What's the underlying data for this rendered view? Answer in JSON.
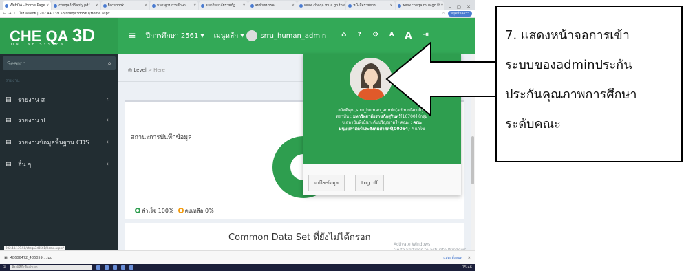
{
  "browser": {
    "tabs": [
      {
        "label": "WebQA - Home Page",
        "active": true
      },
      {
        "label": "cheqa3d3apty.pdf",
        "active": false
      },
      {
        "label": "Facebook",
        "active": false
      },
      {
        "label": "มาตรฐานการศึกษา",
        "active": false
      },
      {
        "label": "มหาวิทยาลัยราชภัฏ",
        "active": false
      },
      {
        "label": "สหพันธมรรค",
        "active": false
      },
      {
        "label": "www.cheqa.mua.go.th",
        "active": false
      },
      {
        "label": "หนังสือราชการ",
        "active": false
      },
      {
        "label": "www.cheqa.mua.go.th",
        "active": false
      }
    ],
    "window_controls": [
      "–",
      "▢",
      "✕"
    ],
    "url": "ไม่ปลอดภัย | 202.44.139.58/cheqa3d3561/Home.aspx",
    "profile_badge": "หยุดชั่วคราว"
  },
  "brand": {
    "logo_che": "CHE QA ",
    "logo_3d": "3D",
    "tagline": "ONLINE SYSTEM"
  },
  "topnav": {
    "menu_icon": "hamburger-icon",
    "academic_year": "ปีการศึกษา 2561 ▾",
    "main_menu": "เมนูหลัก ▾",
    "username": "srru_human_admin",
    "actions": [
      "home-icon",
      "help-icon",
      "settings-icon",
      "font-small-icon",
      "font-large-icon",
      "logout-icon"
    ],
    "action_glyphs": [
      "⌂",
      "?",
      "⚙",
      "A",
      "A",
      "⇥"
    ]
  },
  "sidebar": {
    "search_placeholder": "Search...",
    "search_icon": "🔍",
    "header": "รายงาน",
    "items": [
      {
        "label": "รายงาน ส",
        "icon": "document-icon"
      },
      {
        "label": "รายงาน ป",
        "icon": "document-icon"
      },
      {
        "label": "รายงานข้อมูลพื้นฐาน CDS",
        "icon": "document-icon"
      },
      {
        "label": "อื่น ๆ",
        "icon": "document-icon"
      }
    ],
    "chevron": "‹"
  },
  "content": {
    "breadcrumb_home": "Level",
    "breadcrumb_sep": ">",
    "breadcrumb_here": "Here",
    "box_title": "สถานะการบันทึกข้อมูล",
    "legend_done": "สำเร็จ 100%",
    "legend_left": "คงเหลือ 0%",
    "cds_title": "Common Data Set ที่ยังไม่ได้กรอก",
    "donut_done_percent": 100
  },
  "activate_windows": {
    "line1": "Activate Windows",
    "line2": "Go to Settings to activate Windows."
  },
  "dropdown": {
    "info_line1": "สวัสดีคุณ,srru_human_admin(adminfaculty)",
    "info_line2a": "สถาบัน : ",
    "info_line2b": "มหาวิทยาลัยราชภัฏสุรินทร์",
    "info_line2c": "[16700] (กลุ่ม",
    "info_line3": "ข.สถาบันที่เน้นระดับปริญญาตรี) คณะ : ",
    "info_line3b": "คณะ",
    "info_line4": "มนุษยศาสตร์และสังคมศาสตร์(00064)",
    "info_edit": "แก้ไข",
    "btn_edit": "แก้ไขข้อมูล",
    "btn_logout": "Log off"
  },
  "status_url": "202.44.139.58/cheqa3d3561/Home.aspx#",
  "download_bar": {
    "file": "48606472_486059....jpg",
    "show_all": "แสดงทั้งหมด",
    "close": "✕"
  },
  "taskbar": {
    "search": "พิมพ์ที่นี่เพื่อค้นหา",
    "clock": "15:46"
  },
  "note": {
    "lines": [
      "7. แสดงหน้าจอการเข้า",
      "ระบบของadminประกัน",
      "ประกันคุณภาพการศึกษา",
      "ระดับคณะ"
    ]
  },
  "colors": {
    "brand_green": "#2e9e4f",
    "sidebar_dark": "#222d32",
    "accent_blue": "#4a7bd0",
    "legend_orange": "#f39c12"
  }
}
